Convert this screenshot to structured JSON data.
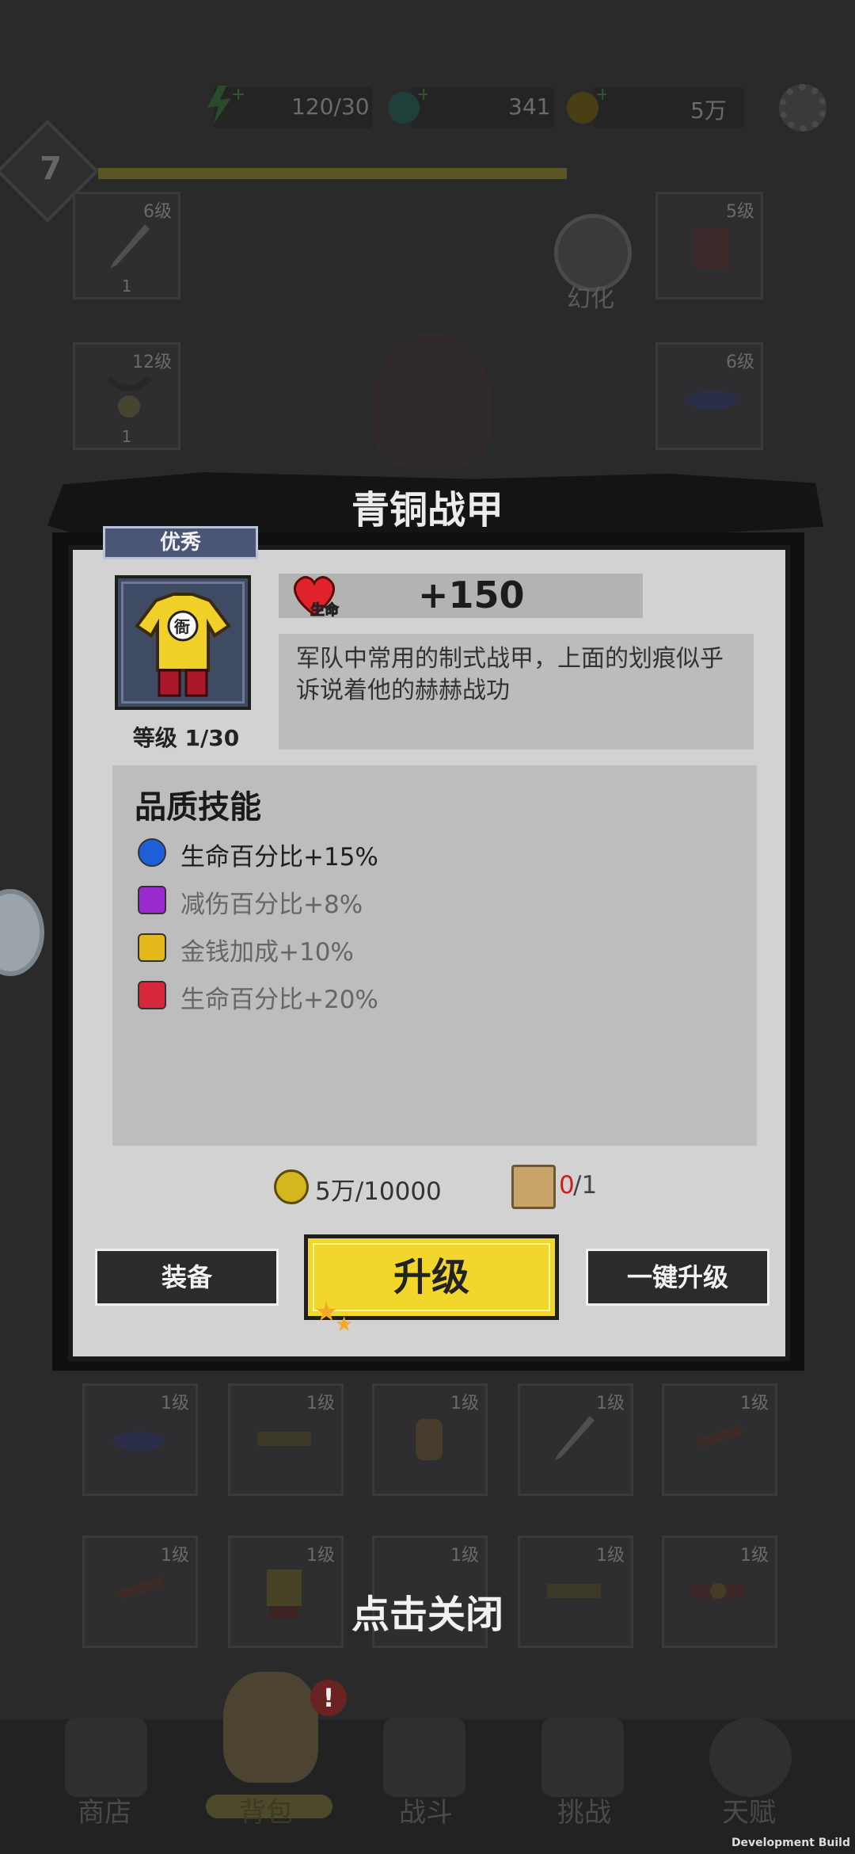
{
  "hud": {
    "energy": "120/30",
    "gems": "341",
    "gold": "5万",
    "player_level": "7"
  },
  "background": {
    "transform_label": "幻化",
    "equip_slots": [
      {
        "level": "6级",
        "count": "1"
      },
      {
        "level": "5级",
        "count": ""
      },
      {
        "level": "12级",
        "count": "1"
      },
      {
        "level": "6级",
        "count": ""
      }
    ],
    "bag_slots_row1": [
      "1级",
      "1级",
      "1级",
      "1级",
      "1级"
    ],
    "bag_slots_row2": [
      "1级",
      "1级",
      "1级",
      "1级",
      "1级"
    ]
  },
  "popup": {
    "title": "青铜战甲",
    "quality": "优秀",
    "item_level": "等级 1/30",
    "stat_label": "生命",
    "stat_value": "+150",
    "description": "军队中常用的制式战甲，上面的划痕似乎诉说着他的赫赫战功",
    "skills_title": "品质技能",
    "skills": [
      {
        "text": "生命百分比+15%",
        "color": "#1e5fd8",
        "locked": false,
        "active": true
      },
      {
        "text": "减伤百分比+8%",
        "color": "#9a2bd0",
        "locked": true,
        "active": false
      },
      {
        "text": "金钱加成+10%",
        "color": "#e2b81c",
        "locked": true,
        "active": false
      },
      {
        "text": "生命百分比+20%",
        "color": "#d8283c",
        "locked": true,
        "active": false
      }
    ],
    "cost_gold": "5万/10000",
    "cost_material_have": "0",
    "cost_material_need": "/1",
    "buttons": {
      "equip": "装备",
      "upgrade": "升级",
      "upgrade_all": "一键升级"
    }
  },
  "close_hint": "点击关闭",
  "nav": {
    "shop": "商店",
    "bag": "背包",
    "battle": "战斗",
    "challenge": "挑战",
    "talent": "天赋"
  },
  "build_label": "Development Build"
}
